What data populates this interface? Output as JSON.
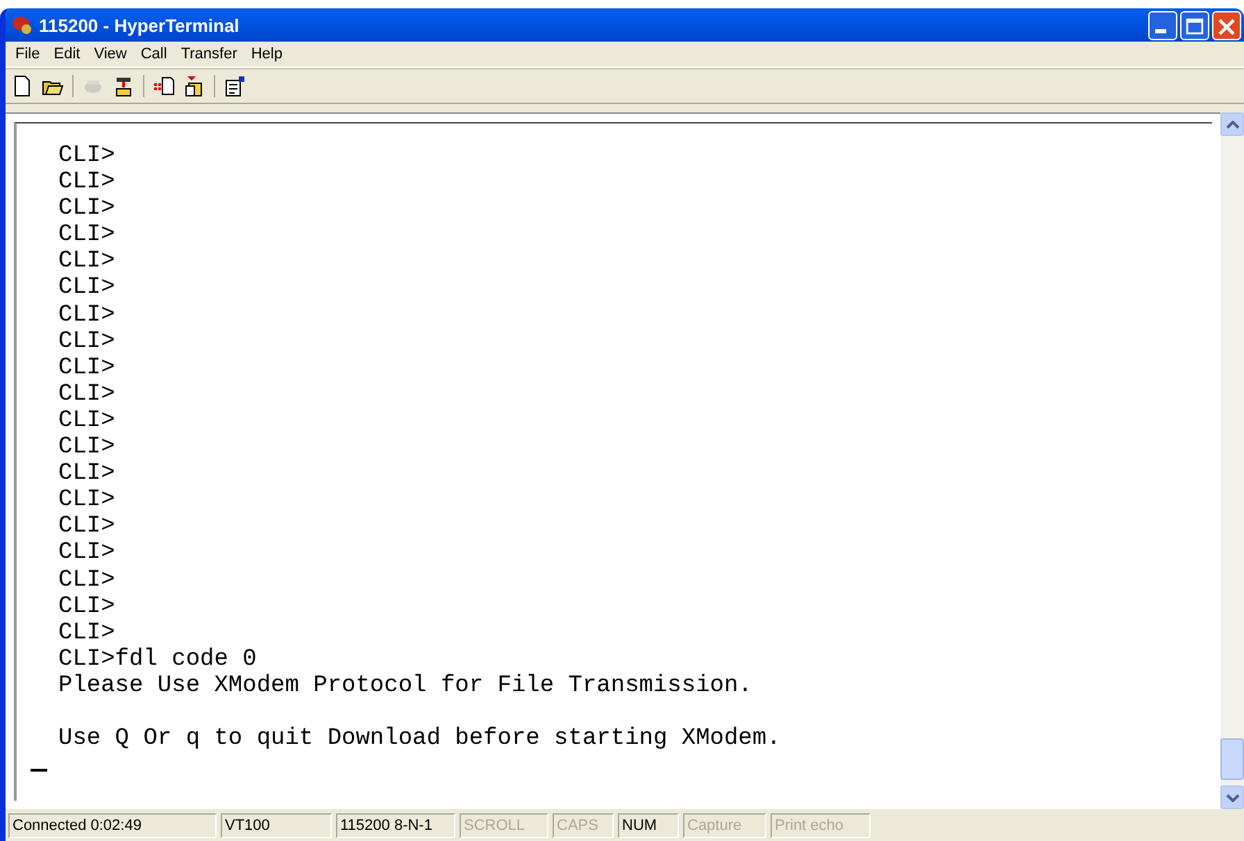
{
  "window": {
    "title": "115200 - HyperTerminal"
  },
  "menu": [
    "File",
    "Edit",
    "View",
    "Call",
    "Transfer",
    "Help"
  ],
  "toolbar": [
    {
      "kind": "new",
      "disabled": false
    },
    {
      "kind": "open",
      "disabled": false
    },
    {
      "kind": "sep"
    },
    {
      "kind": "call",
      "disabled": true
    },
    {
      "kind": "disconnect",
      "disabled": false
    },
    {
      "kind": "sep"
    },
    {
      "kind": "send",
      "disabled": false
    },
    {
      "kind": "receive",
      "disabled": false
    },
    {
      "kind": "sep"
    },
    {
      "kind": "properties",
      "disabled": false
    }
  ],
  "terminal": {
    "blocks": [
      [
        "CLI>",
        "CLI>",
        "CLI>",
        "CLI>",
        "CLI>",
        "CLI>",
        "CLI>",
        "CLI>",
        "CLI>",
        "CLI>",
        "CLI>",
        "CLI>",
        "CLI>",
        "CLI>",
        "CLI>",
        "CLI>",
        "CLI>",
        "CLI>",
        "CLI>",
        "CLI>fdl code 0",
        "Please Use XModem Protocol for File Transmission."
      ],
      [
        "Use Q Or q to quit Download before starting XModem."
      ]
    ],
    "cursor": true
  },
  "status_bar": [
    {
      "text": "Connected 0:02:49",
      "disabled": false
    },
    {
      "text": "VT100",
      "disabled": false
    },
    {
      "text": "115200 8-N-1",
      "disabled": false
    },
    {
      "text": "SCROLL",
      "disabled": true
    },
    {
      "text": "CAPS",
      "disabled": true
    },
    {
      "text": "NUM",
      "disabled": false
    },
    {
      "text": "Capture",
      "disabled": true
    },
    {
      "text": "Print echo",
      "disabled": true
    }
  ]
}
